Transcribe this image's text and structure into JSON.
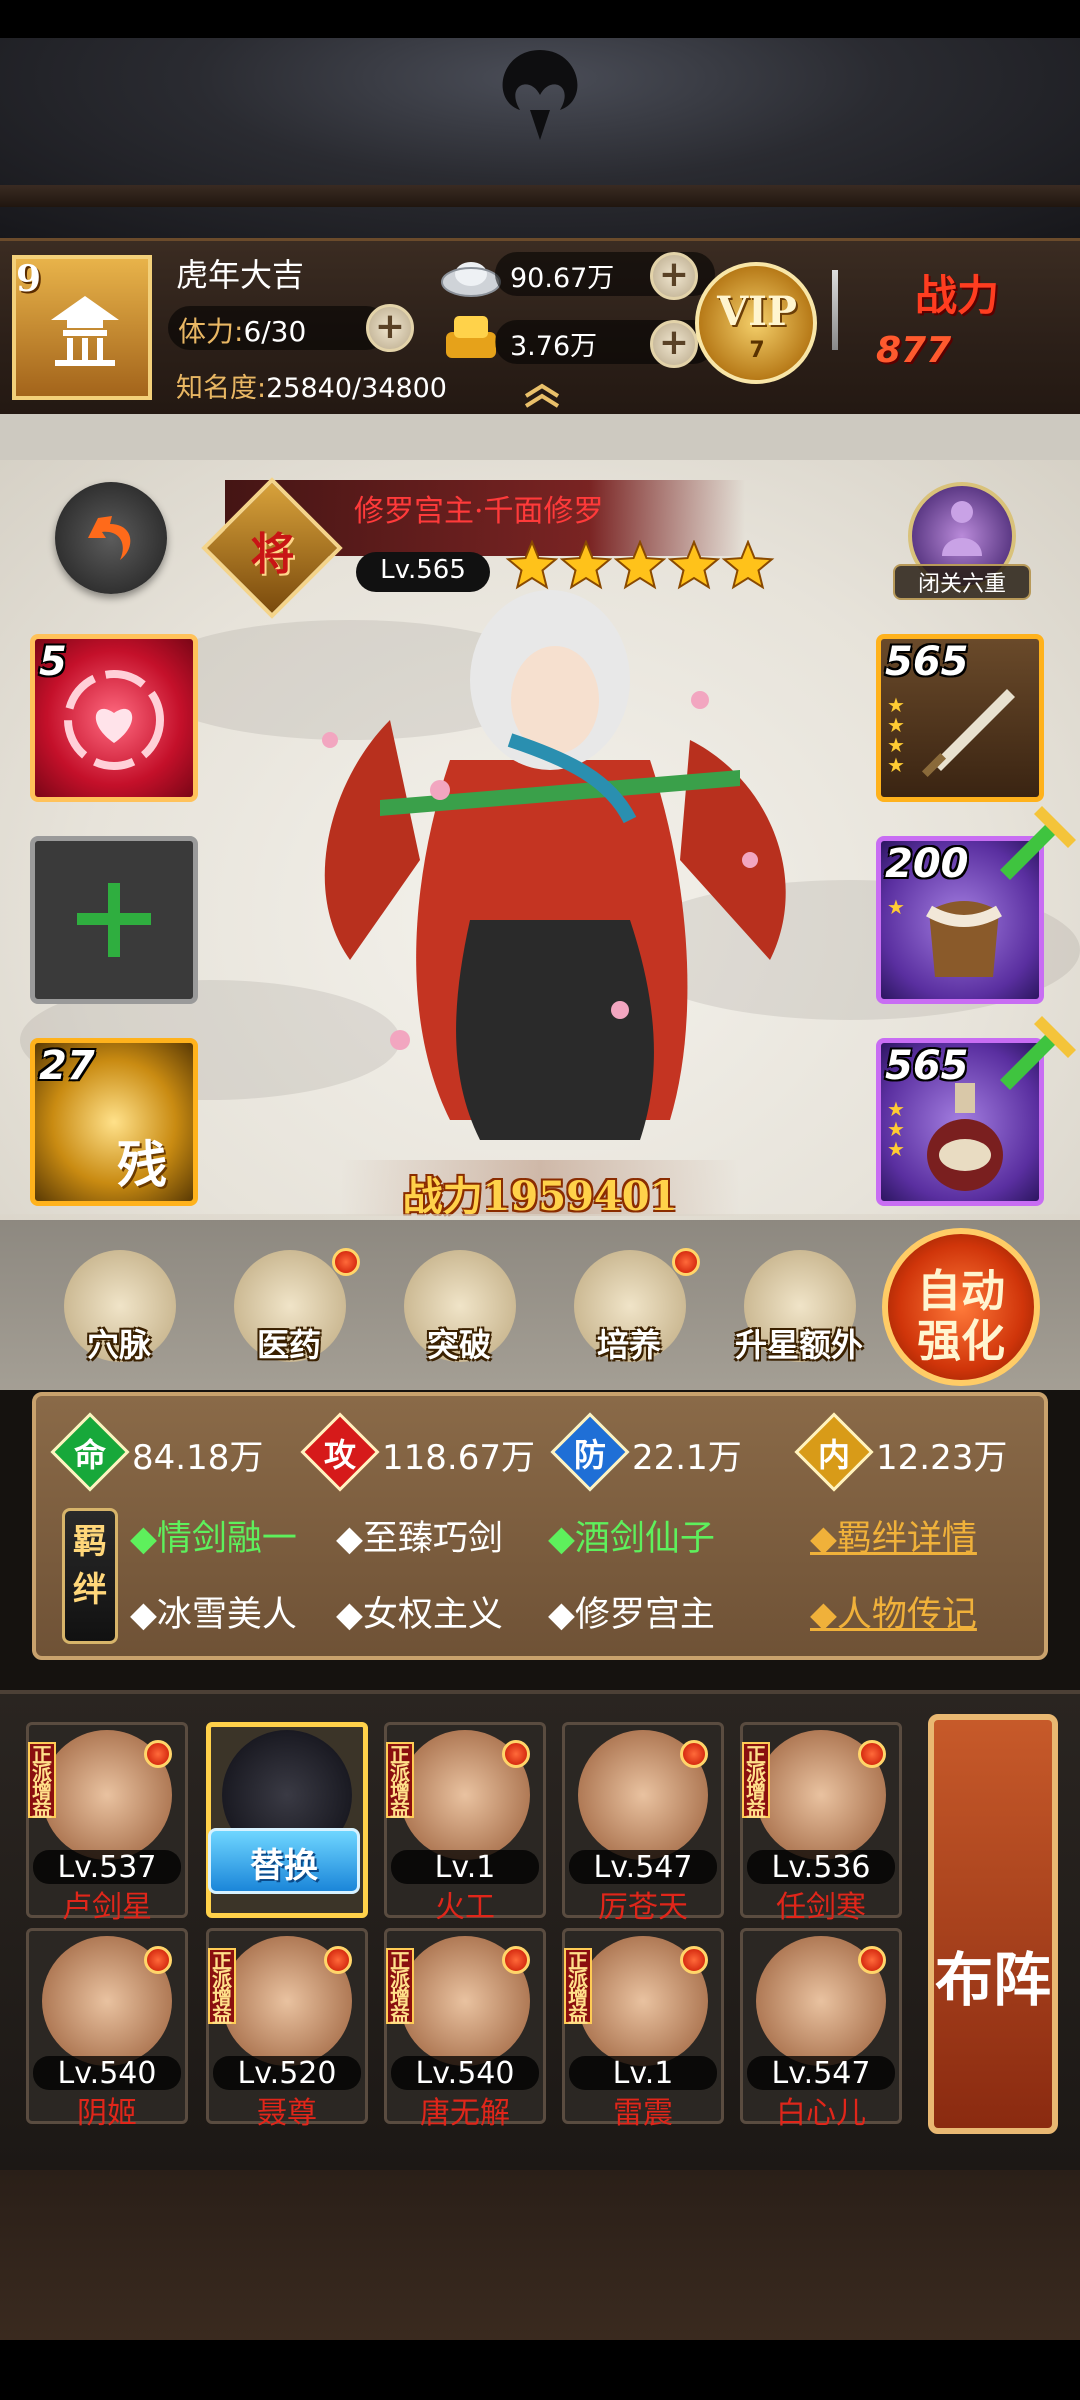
{
  "player": {
    "level": "9",
    "name": "虎年大吉",
    "stamina_label": "体力:",
    "stamina_value": "6/30",
    "fame_label": "知名度:",
    "fame_value": "25840/34800"
  },
  "resources": {
    "silver": "90.67万",
    "gold": "3.76万"
  },
  "vip": {
    "label": "VIP",
    "level": "7"
  },
  "power": {
    "label": "战力",
    "value": "877"
  },
  "hero": {
    "name": "修罗宫主·千面修罗",
    "rank": "将",
    "level": "Lv.565",
    "stars": 5,
    "combat_power": "战力1959401",
    "retreat_label": "闭关六重"
  },
  "slots": {
    "left": [
      {
        "num": "5"
      },
      {
        "num": ""
      },
      {
        "num": "27",
        "label": "残"
      }
    ],
    "right": [
      {
        "num": "565",
        "stars": 4
      },
      {
        "num": "200",
        "stars": 1
      },
      {
        "num": "565",
        "stars": 3
      }
    ]
  },
  "functions": [
    {
      "label": "穴脉",
      "dot": false
    },
    {
      "label": "医药",
      "dot": true
    },
    {
      "label": "突破",
      "dot": false
    },
    {
      "label": "培养",
      "dot": true
    },
    {
      "label": "升星额外",
      "dot": false
    }
  ],
  "auto_strengthen": {
    "line1": "自动",
    "line2": "强化"
  },
  "stats": [
    {
      "char": "命",
      "value": "84.18万",
      "color": "#17a83a"
    },
    {
      "char": "攻",
      "value": "118.67万",
      "color": "#d61a1a"
    },
    {
      "char": "防",
      "value": "22.1万",
      "color": "#1f6fd6"
    },
    {
      "char": "内",
      "value": "12.23万",
      "color": "#d89b18"
    }
  ],
  "fetter": {
    "tag": "羁绊",
    "row1": [
      "◆情剑融一",
      "◆至臻巧剑",
      "◆酒剑仙子"
    ],
    "row2": [
      "◆冰雪美人",
      "◆女权主义",
      "◆修罗宫主"
    ],
    "link1": "◆羁绊详情",
    "link2": "◆人物传记"
  },
  "roster": [
    {
      "level": "Lv.537",
      "name": "卢剑星",
      "faction": true
    },
    {
      "level": "",
      "name": "",
      "faction": false,
      "selected": true,
      "button": "替换"
    },
    {
      "level": "Lv.1",
      "name": "火工",
      "faction": true
    },
    {
      "level": "Lv.547",
      "name": "厉苍天",
      "faction": false
    },
    {
      "level": "Lv.536",
      "name": "任剑寒",
      "faction": true
    },
    {
      "level": "Lv.540",
      "name": "阴姬",
      "faction": false
    },
    {
      "level": "Lv.520",
      "name": "聂尊",
      "faction": true
    },
    {
      "level": "Lv.540",
      "name": "唐无解",
      "faction": true
    },
    {
      "level": "Lv.1",
      "name": "雷震",
      "faction": true
    },
    {
      "level": "Lv.547",
      "name": "白心儿",
      "faction": false
    }
  ],
  "faction_tag": "正派增益",
  "formation_button": "布阵"
}
